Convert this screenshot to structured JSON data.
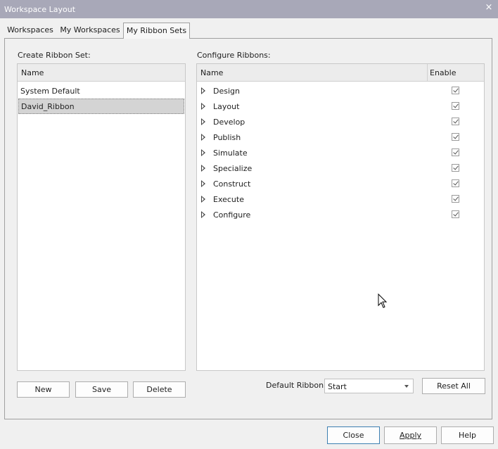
{
  "window": {
    "title": "Workspace Layout",
    "close_glyph": "×"
  },
  "tabs": [
    {
      "label": "Workspaces"
    },
    {
      "label": "My Workspaces"
    },
    {
      "label": "My Ribbon Sets"
    }
  ],
  "left": {
    "heading": "Create Ribbon Set:",
    "column_name": "Name",
    "items": [
      {
        "label": "System Default"
      },
      {
        "label": "David_Ribbon",
        "selected": true
      }
    ],
    "buttons": {
      "new": "New",
      "save": "Save",
      "delete": "Delete"
    }
  },
  "right": {
    "heading": "Configure Ribbons:",
    "column_name": "Name",
    "column_enable": "Enable",
    "ribbons": [
      {
        "label": "Design",
        "enabled": true
      },
      {
        "label": "Layout",
        "enabled": true
      },
      {
        "label": "Develop",
        "enabled": true
      },
      {
        "label": "Publish",
        "enabled": true
      },
      {
        "label": "Simulate",
        "enabled": true
      },
      {
        "label": "Specialize",
        "enabled": true
      },
      {
        "label": "Construct",
        "enabled": true
      },
      {
        "label": "Execute",
        "enabled": true
      },
      {
        "label": "Configure",
        "enabled": true
      }
    ],
    "default_ribbon_label": "Default Ribbon:",
    "default_ribbon_value": "Start",
    "reset_all": "Reset All"
  },
  "footer": {
    "close": "Close",
    "apply": "Apply",
    "help": "Help"
  },
  "colors": {
    "titlebar": "#a8a8b8",
    "default_button_border": "#3c7fb1"
  },
  "icons": [
    "close-icon",
    "expander-icon",
    "checkbox-icon",
    "dropdown-arrow-icon",
    "mouse-cursor-icon"
  ]
}
